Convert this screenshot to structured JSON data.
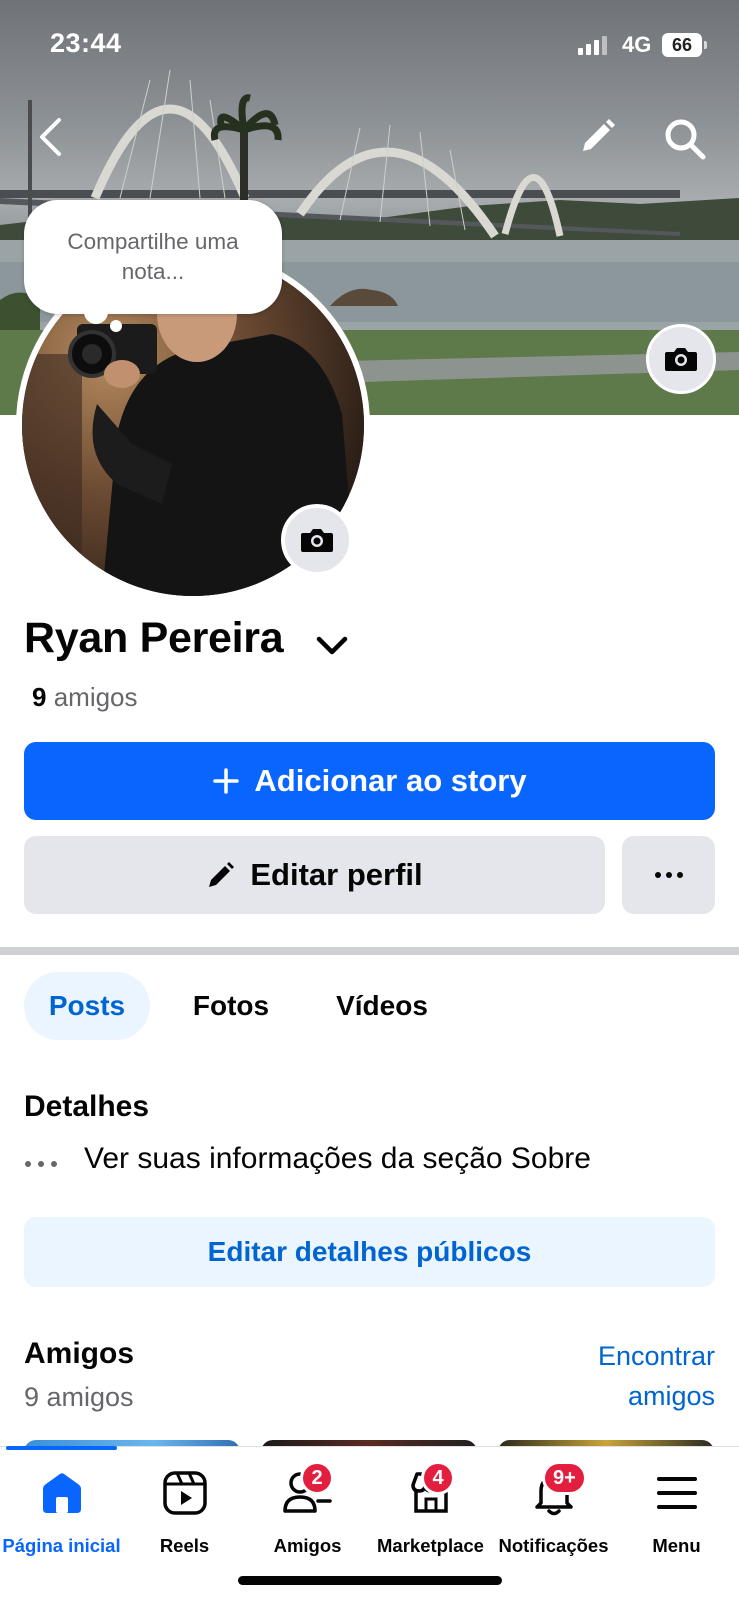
{
  "status_bar": {
    "time": "23:44",
    "network": "4G",
    "battery": "66"
  },
  "header": {
    "back_icon": "chevron-left-icon",
    "edit_icon": "pencil-icon",
    "search_icon": "search-icon"
  },
  "note": {
    "placeholder": "Compartilhe uma nota..."
  },
  "profile": {
    "name": "Ryan Pereira",
    "friends_count": "9",
    "friends_label": "amigos"
  },
  "actions": {
    "add_story": "Adicionar ao story",
    "edit_profile": "Editar perfil",
    "more": "···"
  },
  "tabs": [
    {
      "label": "Posts",
      "active": true
    },
    {
      "label": "Fotos",
      "active": false
    },
    {
      "label": "Vídeos",
      "active": false
    }
  ],
  "details": {
    "title": "Detalhes",
    "about_text": "Ver suas informações da seção Sobre",
    "edit_button": "Editar detalhes públicos"
  },
  "friends": {
    "title": "Amigos",
    "count_text": "9 amigos",
    "find_friends": "Encontrar amigos"
  },
  "bottom_nav": [
    {
      "label": "Página inicial",
      "icon": "home-icon",
      "active": true,
      "badge": ""
    },
    {
      "label": "Reels",
      "icon": "reels-icon",
      "active": false,
      "badge": ""
    },
    {
      "label": "Amigos",
      "icon": "friends-icon",
      "active": false,
      "badge": "2"
    },
    {
      "label": "Marketplace",
      "icon": "marketplace-icon",
      "active": false,
      "badge": "4"
    },
    {
      "label": "Notificações",
      "icon": "bell-icon",
      "active": false,
      "badge": "9+"
    },
    {
      "label": "Menu",
      "icon": "menu-icon",
      "active": false,
      "badge": ""
    }
  ],
  "colors": {
    "accent": "#0866ff",
    "link": "#0064d1",
    "secondary_button": "#e4e6eb",
    "badge": "#e41e3f",
    "text_secondary": "#65676b"
  }
}
